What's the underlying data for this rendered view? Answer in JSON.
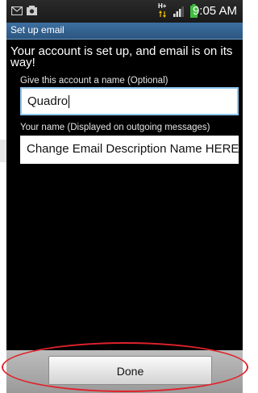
{
  "status_bar": {
    "time": "9:05 AM",
    "network_label": "H+",
    "icons": [
      "email-icon",
      "image-icon",
      "network-data-icon",
      "signal-icon",
      "battery-icon"
    ]
  },
  "title_bar": {
    "title": "Set up email"
  },
  "message": "Your account is set up, and email is on its way!",
  "form": {
    "account_name_label": "Give this account a name (Optional)",
    "account_name_value": "Quadro",
    "your_name_label": "Your name (Displayed on outgoing messages)",
    "your_name_value": "Change Email Description Name HERE"
  },
  "done_label": "Done",
  "colors": {
    "title_bar": "#2f5d8a",
    "focus_border": "#8fc7f0",
    "annotation_ring": "#e0222b",
    "battery": "#3fbf3f"
  }
}
